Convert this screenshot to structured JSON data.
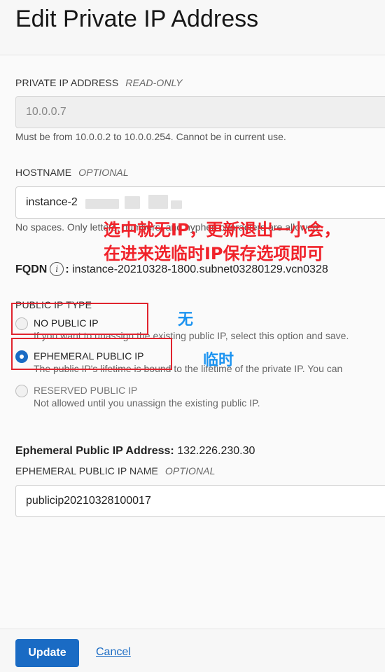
{
  "header": {
    "title": "Edit Private IP Address"
  },
  "private_ip": {
    "label": "PRIVATE IP ADDRESS",
    "qualifier": "READ-ONLY",
    "value": "10.0.0.7",
    "help": "Must be from 10.0.0.2 to 10.0.0.254. Cannot be in current use."
  },
  "hostname": {
    "label": "HOSTNAME",
    "qualifier": "OPTIONAL",
    "value": "instance-2",
    "help": "No spaces. Only letters, numbers, and hyphen characters are allowed."
  },
  "fqdn": {
    "label": "FQDN",
    "info_icon": "info-icon",
    "value": "instance-20210328-1800.subnet03280129.vcn0328"
  },
  "public_ip_type": {
    "label": "PUBLIC IP TYPE",
    "options": [
      {
        "label": "NO PUBLIC IP",
        "desc": "If you want to unassign the existing public IP, select this option and save.",
        "checked": false,
        "disabled": false
      },
      {
        "label": "EPHEMERAL PUBLIC IP",
        "desc": "The public IP's lifetime is bound to the lifetime of the private IP. You can",
        "checked": true,
        "disabled": false
      },
      {
        "label": "RESERVED PUBLIC IP",
        "desc": "Not allowed until you unassign the existing public IP.",
        "checked": false,
        "disabled": true
      }
    ]
  },
  "annotations": {
    "line1": "选中就无IP，更新退出一小会，",
    "line2": "在进来选临时IP保存选项即可",
    "none": "无",
    "temporary": "临时",
    "red_color": "#f0222a",
    "blue_color": "#1b93f0"
  },
  "ephemeral": {
    "address_label": "Ephemeral Public IP Address:",
    "address_value": "132.226.230.30",
    "name_label": "EPHEMERAL PUBLIC IP NAME",
    "name_qualifier": "OPTIONAL",
    "name_value": "publicip20210328100017"
  },
  "footer": {
    "update_label": "Update",
    "cancel_label": "Cancel"
  },
  "colors": {
    "accent": "#1a6bc4"
  }
}
